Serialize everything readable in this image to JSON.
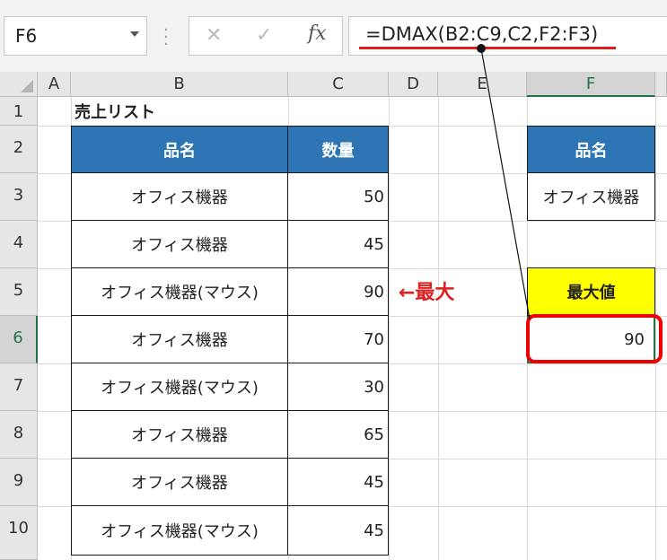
{
  "formula_bar": {
    "name_box": "F6",
    "cancel_icon": "✕",
    "enter_icon": "✓",
    "fx_label": "fx",
    "formula": "=DMAX(B2:C9,C2,F2:F3)"
  },
  "columns": [
    "A",
    "B",
    "C",
    "D",
    "E",
    "F"
  ],
  "rows": [
    "1",
    "2",
    "3",
    "4",
    "5",
    "6",
    "7",
    "8",
    "9",
    "10"
  ],
  "sheet": {
    "title": "売上リスト",
    "table_headers": [
      "品名",
      "数量"
    ],
    "table_rows": [
      {
        "name": "オフィス機器",
        "qty": "50"
      },
      {
        "name": "オフィス機器",
        "qty": "45"
      },
      {
        "name": "オフィス機器(マウス)",
        "qty": "90"
      },
      {
        "name": "オフィス機器",
        "qty": "70"
      },
      {
        "name": "オフィス機器(マウス)",
        "qty": "30"
      },
      {
        "name": "オフィス機器",
        "qty": "65"
      },
      {
        "name": "オフィス機器",
        "qty": "45"
      },
      {
        "name": "オフィス機器(マウス)",
        "qty": "45"
      }
    ],
    "criteria_header": "品名",
    "criteria_value": "オフィス機器",
    "result_label": "最大値",
    "result_value": "90",
    "annotation": "←最大"
  }
}
